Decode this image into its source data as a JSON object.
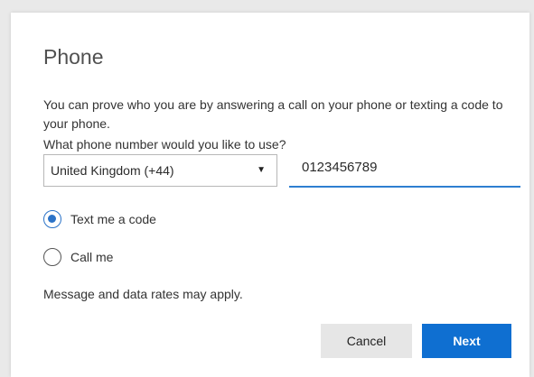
{
  "dialog": {
    "title": "Phone",
    "description": "You can prove who you are by answering a call on your phone or texting a code to your phone.",
    "question": "What phone number would you like to use?",
    "country": {
      "selected": "United Kingdom (+44)",
      "arrow": "▼"
    },
    "phone": {
      "value": "0123456789"
    },
    "options": [
      {
        "label": "Text me a code",
        "selected": true
      },
      {
        "label": "Call me",
        "selected": false
      }
    ],
    "note": "Message and data rates may apply.",
    "buttons": {
      "cancel_label": "Cancel",
      "next_label": "Next"
    }
  },
  "colors": {
    "accent": "#0f6fd1",
    "radio_selected": "#2b73c8",
    "input_underline": "#2e7fd1"
  }
}
